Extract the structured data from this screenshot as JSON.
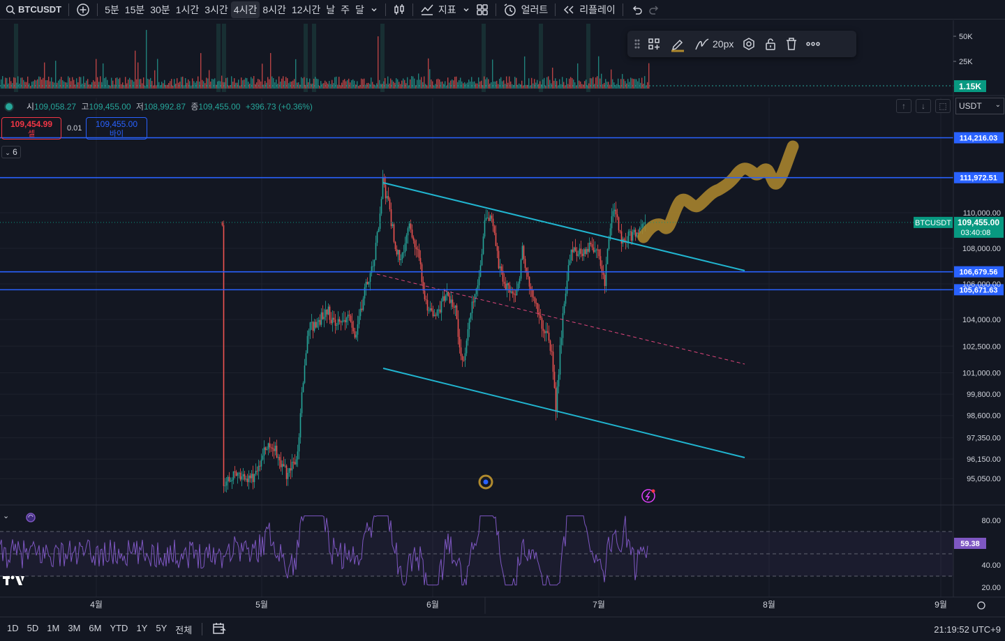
{
  "toolbar": {
    "symbol": "BTCUSDT",
    "intervals": [
      "5분",
      "15분",
      "30분",
      "1시간",
      "3시간",
      "4시간",
      "8시간",
      "12시간",
      "날",
      "주",
      "달"
    ],
    "active_interval": "4시간",
    "indicators_label": "지표",
    "alert_label": "얼러트",
    "replay_label": "리플레이"
  },
  "drawing_toolbar": {
    "line_width_label": "20px",
    "brush_color": "#b08a2e"
  },
  "legend": {
    "open_key": "시",
    "open": "109,058.27",
    "high_key": "고",
    "high": "109,455.00",
    "low_key": "저",
    "low": "108,992.87",
    "close_key": "종",
    "close": "109,455.00",
    "change": "+396.73 (+0.36%)"
  },
  "trade": {
    "sell_price": "109,454.99",
    "sell_label": "셀",
    "spread": "0.01",
    "buy_price": "109,455.00",
    "buy_label": "바이"
  },
  "collapse_count": "6",
  "currency": "USDT",
  "volume_axis": [
    "50K",
    "25K"
  ],
  "volume_last": "1.15K",
  "price_axis": [
    "110,000.00",
    "108,000.00",
    "106,000.00",
    "104,000.00",
    "102,500.00",
    "101,000.00",
    "99,800.00",
    "98,600.00",
    "97,350.00",
    "96,150.00",
    "95,050.00"
  ],
  "horizontal_lines": [
    {
      "price": "114,216.03",
      "color": "#2962ff"
    },
    {
      "price": "111,972.51",
      "color": "#2962ff"
    },
    {
      "price": "106,679.56",
      "color": "#2962ff"
    },
    {
      "price": "105,671.63",
      "color": "#2962ff"
    }
  ],
  "current_price": {
    "symbol_label": "BTCUSDT",
    "price": "109,455.00",
    "countdown": "03:40:08",
    "color": "#089981"
  },
  "rsi": {
    "axis": [
      "80.00",
      "40.00",
      "20.00"
    ],
    "value": "59.38",
    "color": "#7e57c2"
  },
  "time_axis": [
    "4월",
    "5월",
    "6월",
    "7월",
    "8월",
    "9월"
  ],
  "bottom": {
    "ranges": [
      "1D",
      "5D",
      "1M",
      "3M",
      "6M",
      "YTD",
      "1Y",
      "5Y",
      "전체"
    ],
    "clock": "21:19:52 UTC+9"
  },
  "colors": {
    "up": "#26a69a",
    "down": "#ef5350",
    "channel": "#21b5d0",
    "midline": "#e0467c",
    "background": "#131722"
  }
}
